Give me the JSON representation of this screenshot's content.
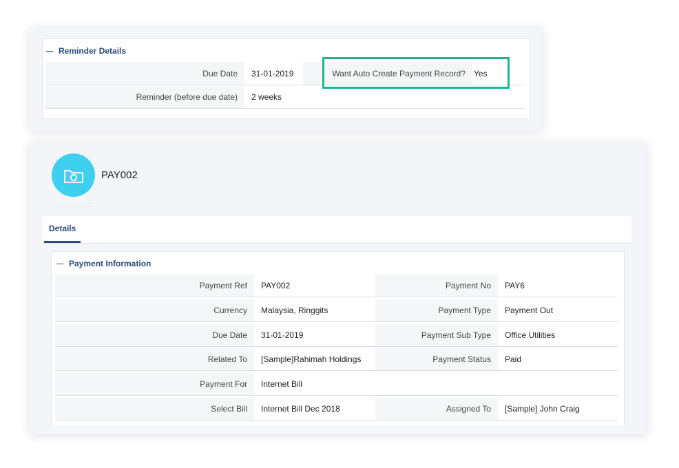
{
  "reminder": {
    "title": "Reminder Details",
    "rows": [
      {
        "label": "Due Date",
        "value": "31-01-2019",
        "label2": "Want Auto Create Payment Record?",
        "value2": "Yes"
      },
      {
        "label": "Reminder (before due date)",
        "value": "2 weeks"
      }
    ]
  },
  "record": {
    "title": "PAY002",
    "icon": "folder-camera-icon"
  },
  "tabs": [
    {
      "label": "Details"
    }
  ],
  "payment": {
    "title": "Payment Information",
    "rows": [
      {
        "label": "Payment Ref",
        "value": "PAY002",
        "label2": "Payment No",
        "value2": "PAY6"
      },
      {
        "label": "Currency",
        "value": "Malaysia, Ringgits",
        "label2": "Payment Type",
        "value2": "Payment Out"
      },
      {
        "label": "Due Date",
        "value": "31-01-2019",
        "label2": "Payment Sub Type",
        "value2": "Office Utilities"
      },
      {
        "label": "Related To",
        "value": "[Sample]Rahimah Holdings",
        "label2": "Payment Status",
        "value2": "Paid"
      },
      {
        "label": "Payment For",
        "value": "Internet Bill"
      },
      {
        "label": "Select Bill",
        "value": "Internet Bill Dec 2018",
        "label2": "Assigned To",
        "value2": "[Sample] John Craig"
      }
    ]
  },
  "colors": {
    "accent": "#2b4a7e",
    "highlight": "#1fb592",
    "avatar": "#3fd0f0"
  }
}
